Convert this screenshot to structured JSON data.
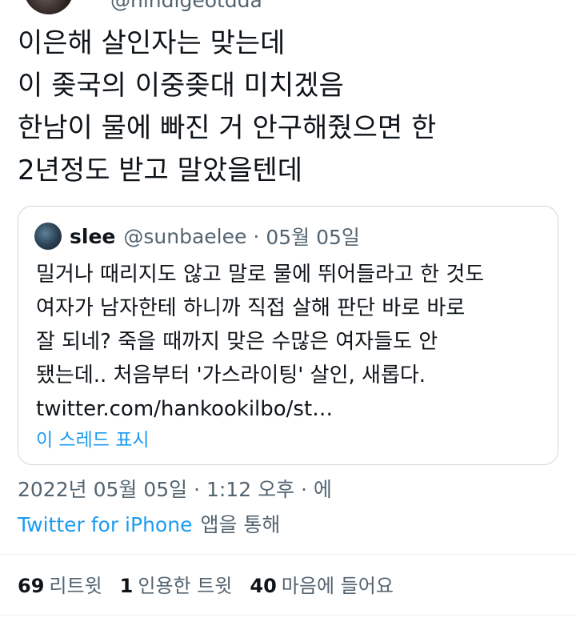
{
  "author": {
    "handle": "@hindigeotdda"
  },
  "tweet": {
    "lines": [
      "이은해 살인자는 맞는데",
      "이 좆국의 이중좆대 미치겠음",
      "한남이 물에 빠진 거 안구해줬으면 한",
      "2년정도 받고 말았을텐데"
    ]
  },
  "quote": {
    "name": "slee",
    "handle": "@sunbaelee",
    "separator": "·",
    "date": "05월 05일",
    "lines": [
      "밀거나 때리지도 않고 말로 물에 뛰어들라고 한 것도",
      "여자가 남자한테 하니까 직접 살해 판단 바로 바로",
      "잘 되네? 죽을 때까지 맞은 수많은 여자들도 안",
      "됐는데.. 처음부터 '가스라이팅' 살인, 새롭다.",
      "twitter.com/hankookilbo/st…"
    ],
    "show_thread": "이 스레드 표시"
  },
  "meta": {
    "timestamp": "2022년 05월 05일 · 1:12 오후 · 에",
    "source": "Twitter for iPhone",
    "via": "앱을 통해"
  },
  "stats": {
    "retweets_count": "69",
    "retweets_label": "리트윗",
    "quotes_count": "1",
    "quotes_label": "인용한 트윗",
    "likes_count": "40",
    "likes_label": "마음에 들어요"
  },
  "colors": {
    "accent": "#1d9bf0",
    "text": "#0f1419",
    "muted": "#536471",
    "border": "#cfd9de"
  }
}
